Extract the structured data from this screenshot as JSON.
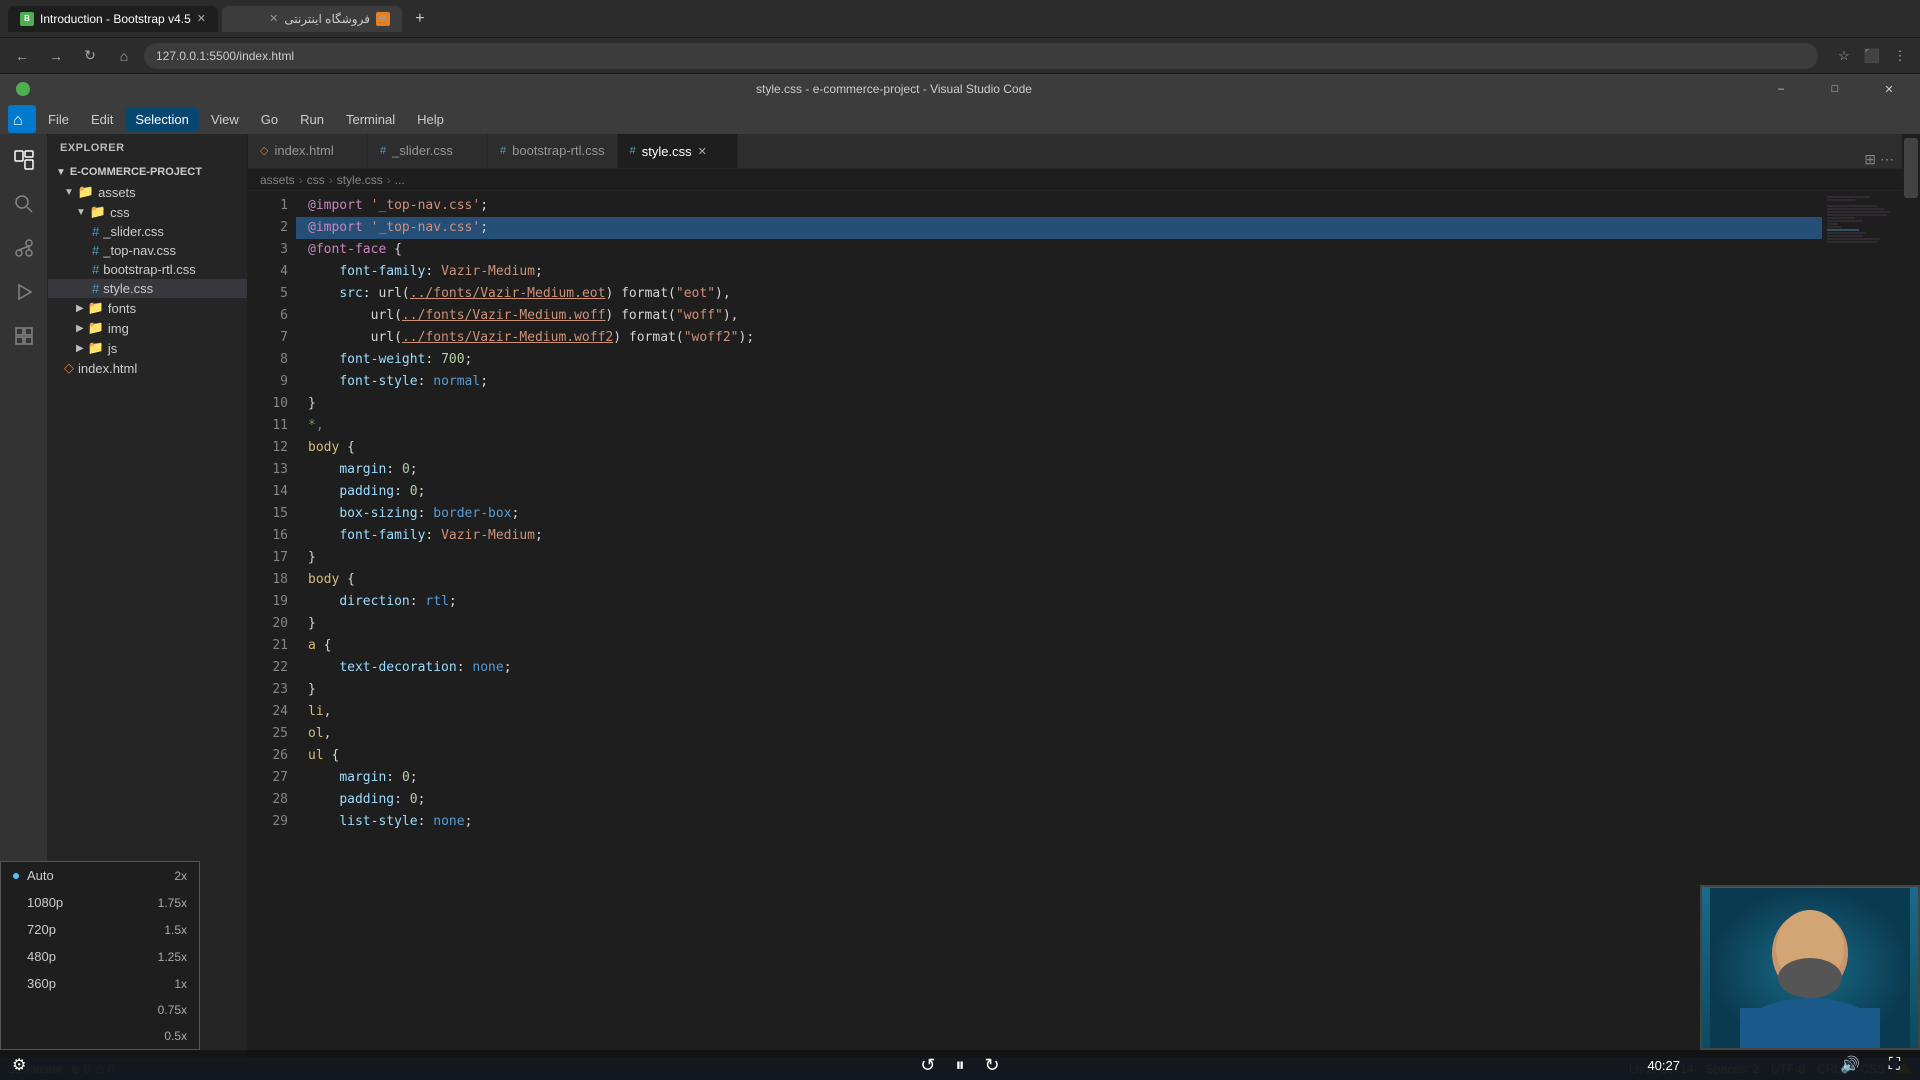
{
  "browser": {
    "tabs": [
      {
        "id": "tab1",
        "label": "Introduction - Bootstrap v4.5",
        "active": true,
        "favicon_color": "#4caf50"
      },
      {
        "id": "tab2",
        "label": "فروشگاه اینترنتی",
        "active": false,
        "favicon_color": "#e67e22"
      }
    ],
    "address": "127.0.0.1:5500/index.html",
    "new_tab_label": "+"
  },
  "vscode": {
    "title": "style.css - e-commerce-project - Visual Studio Code",
    "menu_items": [
      "File",
      "Edit",
      "Selection",
      "View",
      "Go",
      "Run",
      "Terminal",
      "Help"
    ],
    "active_menu": "Selection"
  },
  "sidebar": {
    "header": "EXPLORER",
    "project_name": "E-COMMERCE-PROJECT",
    "items": [
      {
        "type": "folder",
        "name": "assets",
        "open": true,
        "indent": 0
      },
      {
        "type": "folder",
        "name": "css",
        "open": true,
        "indent": 1
      },
      {
        "type": "file",
        "name": "_slider.css",
        "indent": 2
      },
      {
        "type": "file",
        "name": "_top-nav.css",
        "indent": 2
      },
      {
        "type": "file",
        "name": "bootstrap-rtl.css",
        "indent": 2
      },
      {
        "type": "file",
        "name": "style.css",
        "indent": 2,
        "active": true
      },
      {
        "type": "folder",
        "name": "fonts",
        "open": false,
        "indent": 1
      },
      {
        "type": "folder",
        "name": "img",
        "open": false,
        "indent": 1
      },
      {
        "type": "folder",
        "name": "js",
        "open": false,
        "indent": 1
      },
      {
        "type": "file",
        "name": "index.html",
        "indent": 0,
        "ext": "html"
      }
    ]
  },
  "editor": {
    "tabs": [
      {
        "label": "index.html",
        "active": false
      },
      {
        "label": "_slider.css",
        "active": false
      },
      {
        "label": "bootstrap-rtl.css",
        "active": false
      },
      {
        "label": "style.css",
        "active": true,
        "closable": true
      }
    ],
    "breadcrumb": [
      "assets",
      ">",
      "css",
      ">",
      "style.css",
      ">",
      "..."
    ]
  },
  "code_lines": [
    {
      "num": 1,
      "tokens": [
        {
          "t": "k-atrule",
          "v": "@import"
        },
        {
          "t": "",
          "v": " "
        },
        {
          "t": "k-string",
          "v": "'_top-nav.css'"
        },
        {
          "t": "",
          "v": ";"
        }
      ]
    },
    {
      "num": 2,
      "tokens": [
        {
          "t": "k-atrule",
          "v": "@import"
        },
        {
          "t": "",
          "v": " "
        },
        {
          "t": "k-string",
          "v": "'_top-nav.css'"
        },
        {
          "t": "",
          "v": ";"
        }
      ],
      "highlight": true
    },
    {
      "num": 3,
      "tokens": [
        {
          "t": "k-atrule",
          "v": "@font-face"
        },
        {
          "t": "",
          "v": " {"
        }
      ]
    },
    {
      "num": 4,
      "tokens": [
        {
          "t": "",
          "v": "    "
        },
        {
          "t": "k-property",
          "v": "font-family"
        },
        {
          "t": "",
          "v": ": "
        },
        {
          "t": "k-value",
          "v": "Vazir-Medium"
        },
        {
          "t": "",
          "v": ";"
        }
      ]
    },
    {
      "num": 5,
      "tokens": [
        {
          "t": "",
          "v": "    "
        },
        {
          "t": "k-property",
          "v": "src"
        },
        {
          "t": "",
          "v": ": url("
        },
        {
          "t": "k-url",
          "v": "../fonts/Vazir-Medium.eot"
        },
        {
          "t": "",
          "v": ") format("
        },
        {
          "t": "k-string",
          "v": "\"eot\""
        },
        {
          "t": "",
          "v": "),"
        }
      ]
    },
    {
      "num": 6,
      "tokens": [
        {
          "t": "",
          "v": "        url("
        },
        {
          "t": "k-url",
          "v": "../fonts/Vazir-Medium.woff"
        },
        {
          "t": "",
          "v": ") format("
        },
        {
          "t": "k-string",
          "v": "\"woff\""
        },
        {
          "t": "",
          "v": "),"
        }
      ]
    },
    {
      "num": 7,
      "tokens": [
        {
          "t": "",
          "v": "        url("
        },
        {
          "t": "k-url",
          "v": "../fonts/Vazir-Medium.woff2"
        },
        {
          "t": "",
          "v": ") format("
        },
        {
          "t": "k-string",
          "v": "\"woff2\""
        },
        {
          "t": "",
          "v": ");"
        }
      ]
    },
    {
      "num": 8,
      "tokens": [
        {
          "t": "",
          "v": "    "
        },
        {
          "t": "k-property",
          "v": "font-weight"
        },
        {
          "t": "",
          "v": ": "
        },
        {
          "t": "k-value-num",
          "v": "700"
        },
        {
          "t": "",
          "v": ";"
        }
      ]
    },
    {
      "num": 9,
      "tokens": [
        {
          "t": "",
          "v": "    "
        },
        {
          "t": "k-property",
          "v": "font-style"
        },
        {
          "t": "",
          "v": ": "
        },
        {
          "t": "k-value-kw",
          "v": "normal"
        },
        {
          "t": "",
          "v": ";"
        }
      ]
    },
    {
      "num": 10,
      "tokens": [
        {
          "t": "",
          "v": "}"
        }
      ]
    },
    {
      "num": 11,
      "tokens": [
        {
          "t": "k-comment",
          "v": "*,"
        }
      ]
    },
    {
      "num": 12,
      "tokens": [
        {
          "t": "k-selector",
          "v": "body"
        },
        {
          "t": "",
          "v": " {"
        }
      ]
    },
    {
      "num": 13,
      "tokens": [
        {
          "t": "",
          "v": "    "
        },
        {
          "t": "k-property",
          "v": "margin"
        },
        {
          "t": "",
          "v": ": "
        },
        {
          "t": "k-value-num",
          "v": "0"
        },
        {
          "t": "",
          "v": ";"
        }
      ]
    },
    {
      "num": 14,
      "tokens": [
        {
          "t": "",
          "v": "    "
        },
        {
          "t": "k-property",
          "v": "padding"
        },
        {
          "t": "",
          "v": ": "
        },
        {
          "t": "k-value-num",
          "v": "0"
        },
        {
          "t": "",
          "v": ";"
        }
      ]
    },
    {
      "num": 15,
      "tokens": [
        {
          "t": "",
          "v": "    "
        },
        {
          "t": "k-property",
          "v": "box-sizing"
        },
        {
          "t": "",
          "v": ": "
        },
        {
          "t": "k-value-kw",
          "v": "border-box"
        },
        {
          "t": "",
          "v": ";"
        }
      ]
    },
    {
      "num": 16,
      "tokens": [
        {
          "t": "",
          "v": "    "
        },
        {
          "t": "k-property",
          "v": "font-family"
        },
        {
          "t": "",
          "v": ": "
        },
        {
          "t": "k-value",
          "v": "Vazir-Medium"
        },
        {
          "t": "",
          "v": ";"
        }
      ]
    },
    {
      "num": 17,
      "tokens": [
        {
          "t": "",
          "v": "}"
        }
      ]
    },
    {
      "num": 18,
      "tokens": [
        {
          "t": "k-selector",
          "v": "body"
        },
        {
          "t": "",
          "v": " {"
        }
      ]
    },
    {
      "num": 19,
      "tokens": [
        {
          "t": "",
          "v": "    "
        },
        {
          "t": "k-property",
          "v": "direction"
        },
        {
          "t": "",
          "v": ": "
        },
        {
          "t": "k-value-kw",
          "v": "rtl"
        },
        {
          "t": "",
          "v": ";"
        }
      ]
    },
    {
      "num": 20,
      "tokens": [
        {
          "t": "",
          "v": "}"
        }
      ]
    },
    {
      "num": 21,
      "tokens": [
        {
          "t": "k-selector",
          "v": "a"
        },
        {
          "t": "",
          "v": " {"
        }
      ]
    },
    {
      "num": 22,
      "tokens": [
        {
          "t": "",
          "v": "    "
        },
        {
          "t": "k-property",
          "v": "text-decoration"
        },
        {
          "t": "",
          "v": ": "
        },
        {
          "t": "k-value-kw",
          "v": "none"
        },
        {
          "t": "",
          "v": ";"
        }
      ]
    },
    {
      "num": 23,
      "tokens": [
        {
          "t": "",
          "v": "}"
        }
      ]
    },
    {
      "num": 24,
      "tokens": [
        {
          "t": "k-selector",
          "v": "li"
        },
        {
          "t": "",
          "v": ","
        }
      ]
    },
    {
      "num": 25,
      "tokens": [
        {
          "t": "k-selector",
          "v": "ol"
        },
        {
          "t": "",
          "v": ","
        }
      ]
    },
    {
      "num": 26,
      "tokens": [
        {
          "t": "k-selector",
          "v": "ul"
        },
        {
          "t": "",
          "v": " {"
        }
      ]
    },
    {
      "num": 27,
      "tokens": [
        {
          "t": "",
          "v": "    "
        },
        {
          "t": "k-property",
          "v": "margin"
        },
        {
          "t": "",
          "v": ": "
        },
        {
          "t": "k-value-num",
          "v": "0"
        },
        {
          "t": "",
          "v": ";"
        }
      ]
    },
    {
      "num": 28,
      "tokens": [
        {
          "t": "",
          "v": "    "
        },
        {
          "t": "k-property",
          "v": "padding"
        },
        {
          "t": "",
          "v": ": "
        },
        {
          "t": "k-value-num",
          "v": "0"
        },
        {
          "t": "",
          "v": ";"
        }
      ]
    },
    {
      "num": 29,
      "tokens": [
        {
          "t": "",
          "v": "    "
        },
        {
          "t": "k-property",
          "v": "list-style"
        },
        {
          "t": "",
          "v": ": "
        },
        {
          "t": "k-value-kw",
          "v": "none"
        },
        {
          "t": "",
          "v": ";"
        }
      ]
    }
  ],
  "status_bar": {
    "line_col": "Ln 2, Col 14",
    "spaces": "Spaces: 2",
    "encoding": "UTF-8",
    "line_ending": "CRLF",
    "language": "CSS"
  },
  "speed_menu": {
    "items": [
      {
        "label": "Auto",
        "value": "2x",
        "current": false
      },
      {
        "label": "1080p",
        "value": "1.75x",
        "current": false
      },
      {
        "label": "720p",
        "value": "1.5x",
        "current": false
      },
      {
        "label": "480p",
        "value": "1.25x",
        "current": false
      },
      {
        "label": "360p",
        "value": "1x",
        "current": false
      },
      {
        "label": "",
        "value": "0.75x",
        "current": false
      },
      {
        "label": "",
        "value": "0.5x",
        "current": false
      }
    ]
  },
  "video_controls": {
    "timer": "40:27",
    "rewind_icon": "↺",
    "pause_icon": "⏸",
    "forward_icon": "↻",
    "volume_icon": "🔊",
    "expand_icon": "⛶",
    "gear_icon": "⚙"
  }
}
